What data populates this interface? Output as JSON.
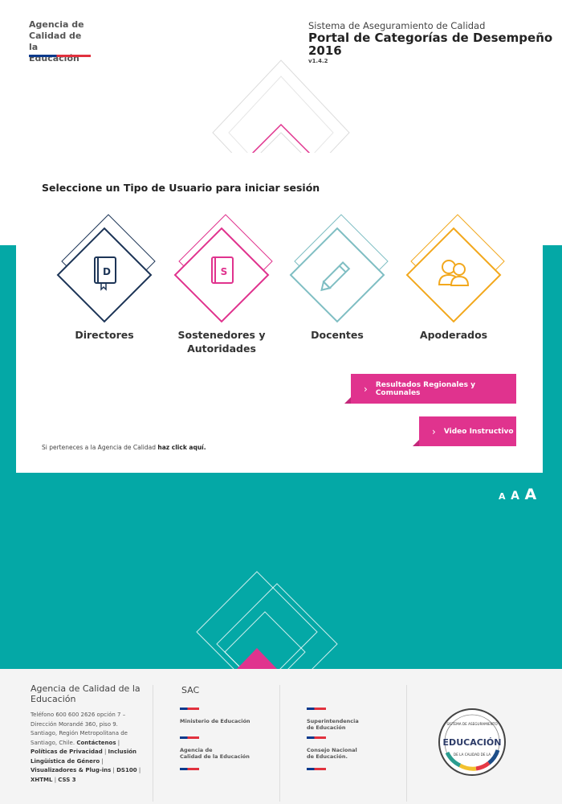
{
  "header": {
    "logo_lines": [
      "Agencia de",
      "Calidad de la",
      "Educación"
    ],
    "system_subtitle": "Sistema de Aseguramiento de Calidad",
    "system_title_1": "Portal de Categorías de Desempeño",
    "system_title_2": "2016",
    "version": "v1.4.2"
  },
  "main": {
    "prompt": "Seleccione un Tipo de Usuario para iniciar sesión",
    "users": [
      {
        "label": "Directores",
        "letter": "D",
        "icon": "book-d-icon",
        "color": "#1d3557"
      },
      {
        "label_1": "Sostenedores y",
        "label_2": "Autoridades",
        "letter": "S",
        "icon": "book-s-icon",
        "color": "#e0338e"
      },
      {
        "label": "Docentes",
        "icon": "pencil-icon",
        "color": "#7fbec3"
      },
      {
        "label": "Apoderados",
        "icon": "parents-icon",
        "color": "#f2a81d"
      }
    ],
    "btn_results": "Resultados Regionales y Comunales",
    "btn_video": "Video Instructivo",
    "click_note_prefix": "Si perteneces a la Agencia de Calidad",
    "click_note_link": "haz click aquí."
  },
  "font_sizer": [
    "A",
    "A",
    "A"
  ],
  "footer": {
    "org_title": "Agencia de Calidad de la Educación",
    "contact": "Teléfono 600 600 2626 opción 7 – Dirección Morandé 360, piso 9. Santiago, Región Metropolitana de Santiago, Chile.",
    "links": [
      "Contáctenos",
      "Políticas de Privacidad",
      "Inclusión Lingüística de Género",
      "Visualizadores & Plug-ins",
      "DS100",
      "XHTML",
      "CSS 3"
    ],
    "sac": "SAC",
    "institutions": [
      {
        "line1": "Ministerio de Educación",
        "line2": ""
      },
      {
        "line1": "Agencia de",
        "line2": "Calidad de la Educación"
      },
      {
        "line1": "Superintendencia",
        "line2": "de Educación"
      },
      {
        "line1": "Consejo Nacional",
        "line2": "de Educación."
      }
    ],
    "seal_top": "SISTEMA DE ASEGURAMIENTO",
    "seal_main": "EDUCACIÓN",
    "seal_bottom": "DE LA CALIDAD DE LA"
  },
  "colors": {
    "teal": "#04a8a6",
    "pink": "#e0338e",
    "navy": "#1d3557",
    "light_teal": "#7fbec3",
    "orange": "#f2a81d"
  }
}
